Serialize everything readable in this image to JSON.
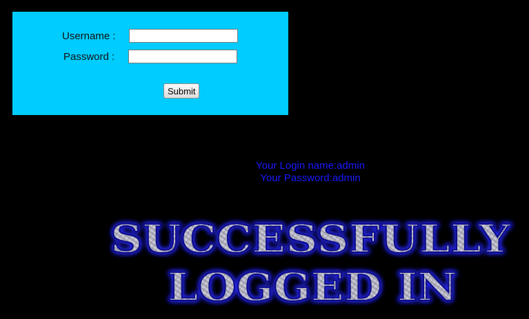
{
  "login_form": {
    "username_label": "Username :",
    "password_label": "Password :",
    "username_value": "",
    "password_value": "",
    "submit_label": "Submit",
    "panel_color": "#00ccff"
  },
  "login_info": {
    "name_line": "Your Login name:admin",
    "password_line": "Your Password:admin",
    "text_color": "#1a1aff"
  },
  "banner": {
    "line1": "SUCCESSFULLY",
    "line2": "LOGGED IN",
    "glow_color": "#2222ff",
    "fill_color": "#a0a0b4"
  },
  "page": {
    "background": "#000000"
  }
}
